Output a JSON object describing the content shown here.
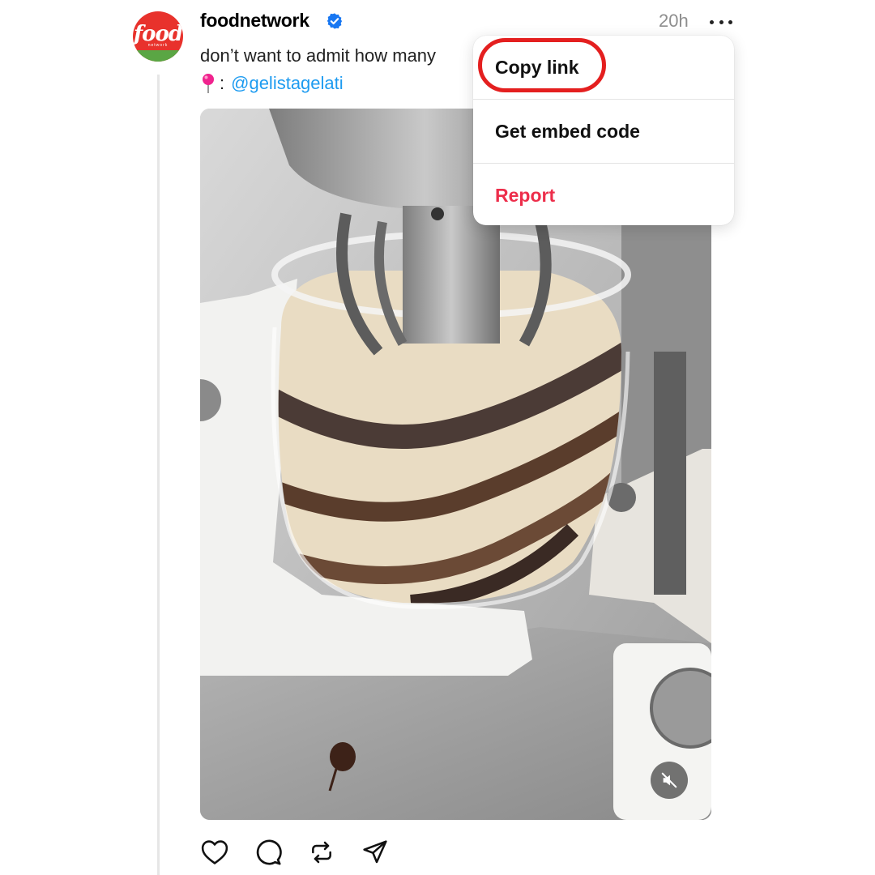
{
  "post": {
    "username": "foodnetwork",
    "verified": true,
    "timestamp": "20h",
    "caption": "don’t want to admit how many",
    "credit_separator": ":",
    "credit_handle": "@gelistagelati",
    "avatar_text": "food",
    "avatar_subtext": "network"
  },
  "menu": {
    "items": [
      {
        "label": "Copy link",
        "highlighted": true
      },
      {
        "label": "Get embed code"
      },
      {
        "label": "Report",
        "style": "danger"
      }
    ]
  },
  "media": {
    "type": "video",
    "muted": true
  },
  "actions": [
    "like-icon",
    "comment-icon",
    "repost-icon",
    "share-icon"
  ],
  "colors": {
    "verified": "#1877f2",
    "link": "#1d9bf0",
    "danger": "#ed2e4b",
    "highlight": "#e41f1f",
    "avatar": "#e8322c"
  }
}
